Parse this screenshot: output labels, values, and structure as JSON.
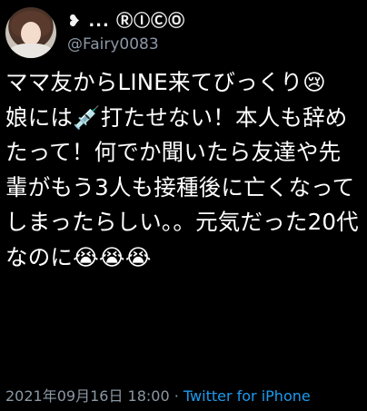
{
  "tweet": {
    "display_name": "❥ ... ⓇⒾⒸⓄ",
    "handle": "@Fairy0083",
    "text": "ママ友からLINE来てびっくり😢\n娘には💉打たせない！本人も辞めたって！何でか聞いたら友達や先輩がもう3人も接種後に亡くなってしまったらしい。。元気だった20代なのに😭😭😭",
    "timestamp": "2021年09月16日 18:00",
    "separator": " · ",
    "source": "Twitter for iPhone"
  }
}
